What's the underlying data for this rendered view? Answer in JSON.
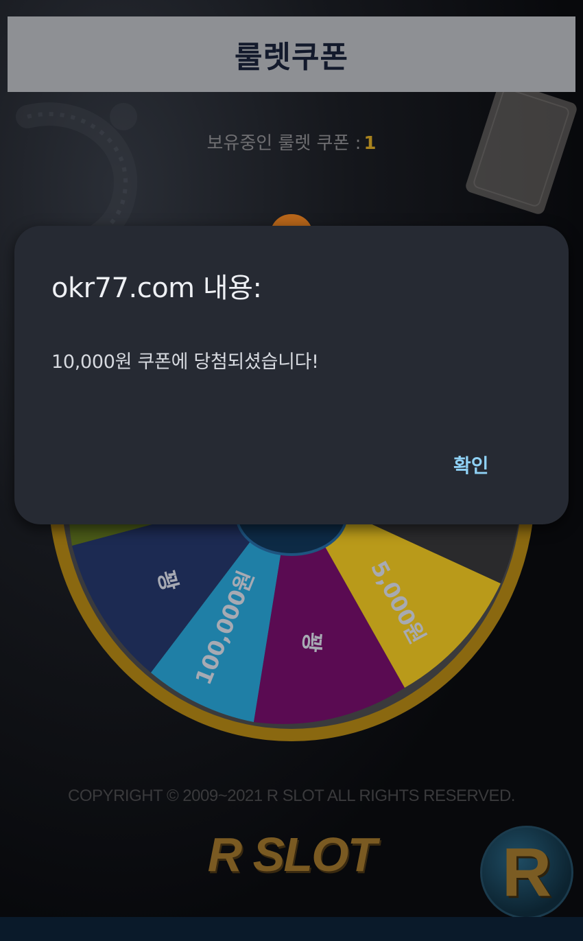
{
  "header": {
    "title": "룰렛쿠폰"
  },
  "coupon": {
    "label": "보유중인 룰렛 쿠폰 :",
    "count": "1"
  },
  "wheel": {
    "segments": [
      {
        "label": "꽝",
        "color": "#1c2a52"
      },
      {
        "label": "100,000원",
        "color": "#1f7fa6"
      },
      {
        "label": "꽝",
        "color": "#5a0b52"
      },
      {
        "label": "5,000원",
        "color": "#b99a1a"
      }
    ],
    "rim_color": "#b88a14"
  },
  "footer": {
    "copyright": "COPYRIGHT © 2009~2021 R SLOT ALL RIGHTS RESERVED.",
    "logo_text": "R SLOT",
    "badge_letter": "R"
  },
  "dialog": {
    "title": "okr77.com 내용:",
    "message": "10,000원 쿠폰에 당첨되셨습니다!",
    "ok_label": "확인"
  }
}
